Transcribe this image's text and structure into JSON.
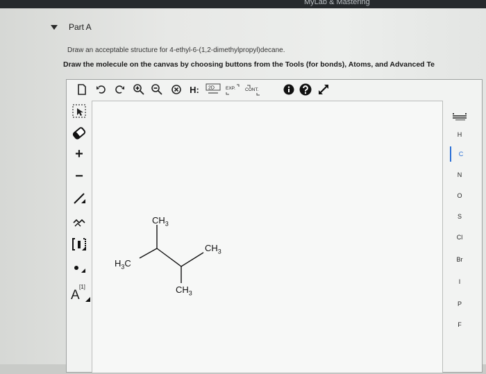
{
  "header": {
    "site_text": "MyLab & Mastering"
  },
  "part": {
    "title": "Part A"
  },
  "prompts": {
    "instruction": "Draw an acceptable structure for 4-ethyl-6-(1,2-dimethylpropyl)decane.",
    "canvas_hint": "Draw the molecule on the canvas by choosing buttons from the Tools (for bonds), Atoms, and Advanced Te"
  },
  "toolbar": {
    "tool_2d": "2D",
    "tool_exp": "EXP.",
    "tool_cont": "CONT.",
    "tool_h": "H:"
  },
  "left_tools": {
    "plus": "+",
    "minus": "−",
    "atom_map_label": "A",
    "atom_map_index": "[1]"
  },
  "atoms": [
    "H",
    "C",
    "N",
    "O",
    "S",
    "Cl",
    "Br",
    "I",
    "P",
    "F"
  ],
  "molecule": {
    "labels": {
      "ch3_top": "CH",
      "ch3_right": "CH",
      "h3c_left": "H",
      "ch3_bottom": "CH",
      "sub3": "3",
      "c": "C"
    }
  },
  "colors": {
    "accent": "#2b6fd6",
    "dark": "#262a2d"
  }
}
